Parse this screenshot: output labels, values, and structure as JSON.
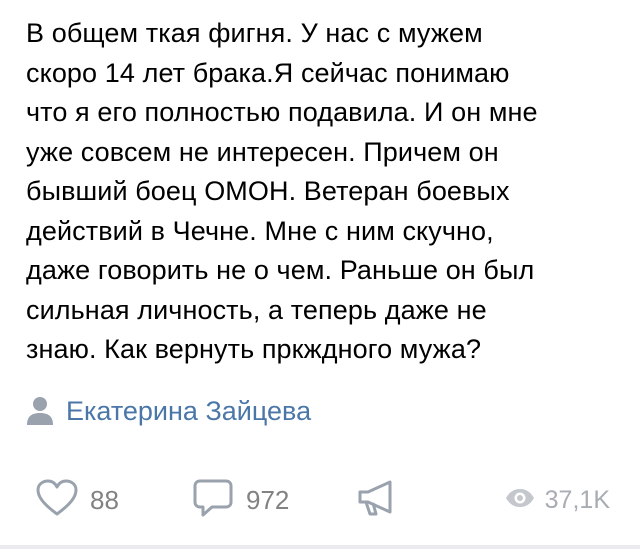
{
  "post": {
    "lines": [
      "В общем ткая фигня. У нас с мужем",
      "скоро 14 лет брака.Я сейчас понимаю",
      "что я его полностью подавила. И он мне",
      "уже совсем не интересен. Причем он",
      "бывший боец ОМОН. Ветеран боевых",
      "действий в Чечне. Мне с ним скучно,",
      "даже говорить не о чем. Раньше он был",
      "сильная личность, а теперь даже не",
      "знаю. Как вернуть пркждного мужа?"
    ]
  },
  "author": {
    "icon": "person-icon",
    "name": "Екатерина Зайцева",
    "color": "#4a76a8"
  },
  "actions": {
    "likes": {
      "icon": "heart-icon",
      "count": "88"
    },
    "comments": {
      "icon": "comment-icon",
      "count": "972"
    },
    "share": {
      "icon": "megaphone-icon"
    },
    "views": {
      "icon": "eye-icon",
      "count": "37,1K"
    }
  },
  "colors": {
    "text": "#000000",
    "icon_gray": "#99a2ad",
    "count_gray": "#828282",
    "views_gray": "#a8adb3"
  }
}
